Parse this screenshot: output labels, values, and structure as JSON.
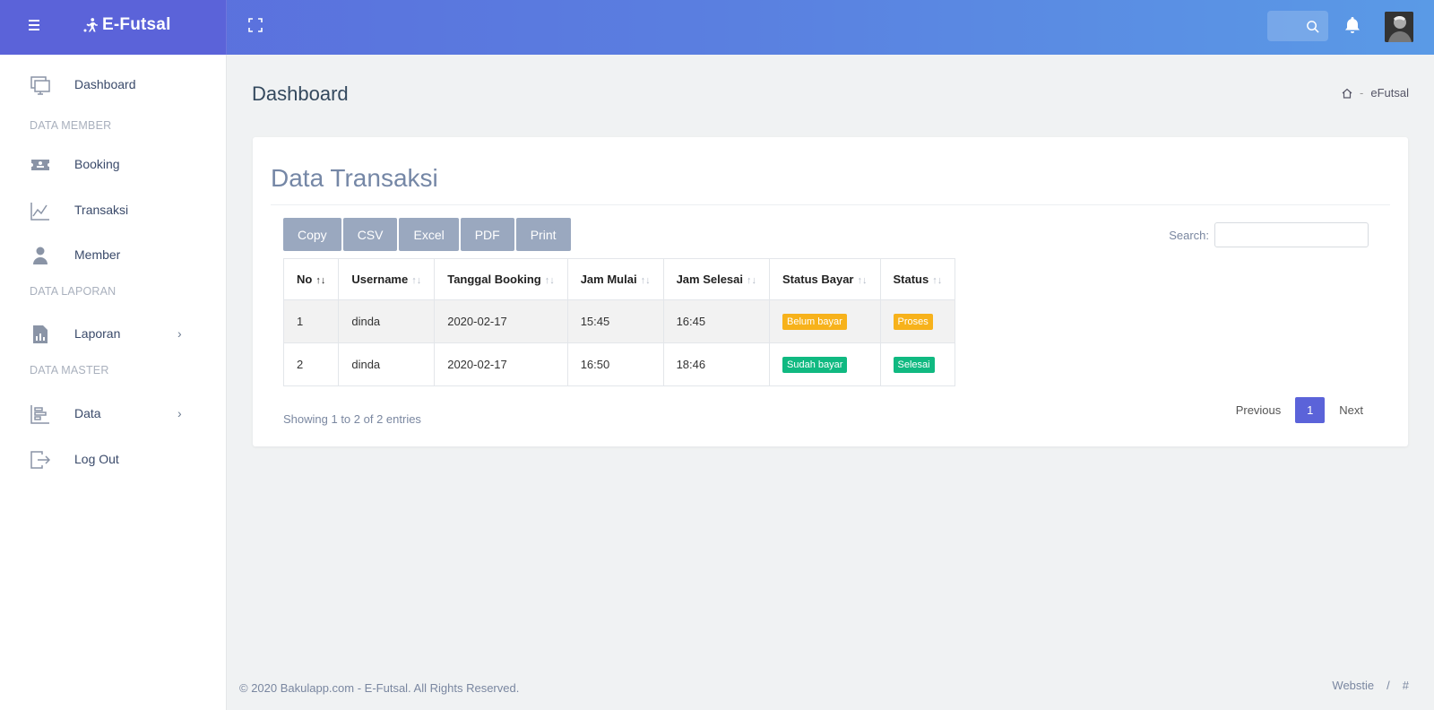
{
  "header": {
    "brand": "E-Futsal",
    "avatar_alt": "user avatar"
  },
  "sidebar": {
    "items": [
      {
        "label": "Dashboard"
      },
      {
        "label": "Booking"
      },
      {
        "label": "Transaksi"
      },
      {
        "label": "Member"
      },
      {
        "label": "Laporan"
      },
      {
        "label": "Data"
      },
      {
        "label": "Log Out"
      }
    ],
    "sections": [
      "DATA MEMBER",
      "DATA LAPORAN",
      "DATA MASTER"
    ]
  },
  "page": {
    "title": "Dashboard",
    "breadcrumb": [
      "eFutsal"
    ]
  },
  "card": {
    "title": "Data Transaksi",
    "buttons": [
      "Copy",
      "CSV",
      "Excel",
      "PDF",
      "Print"
    ],
    "search_label": "Search:",
    "search_value": ""
  },
  "table": {
    "headers": [
      "No",
      "Username",
      "Tanggal Booking",
      "Jam Mulai",
      "Jam Selesai",
      "Status Bayar",
      "Status"
    ],
    "rows": [
      {
        "no": "1",
        "username": "dinda",
        "tanggal": "2020-02-17",
        "mulai": "15:45",
        "selesai": "16:45",
        "bayar": "Belum bayar",
        "status": "Proses"
      },
      {
        "no": "2",
        "username": "dinda",
        "tanggal": "2020-02-17",
        "mulai": "16:50",
        "selesai": "18:46",
        "bayar": "Sudah bayar",
        "status": "Selesai"
      }
    ]
  },
  "pagination": {
    "info": "Showing 1 to 2 of 2 entries",
    "previous": "Previous",
    "current": "1",
    "next": "Next"
  },
  "footer": {
    "copyright": "© 2020 Bakulapp.com - E-Futsal. All Rights Reserved.",
    "links": [
      "Webstie",
      "/",
      "#"
    ]
  },
  "colors": {
    "warning": "#f7b21b",
    "success": "#10b981",
    "primary": "#5b63d9"
  }
}
